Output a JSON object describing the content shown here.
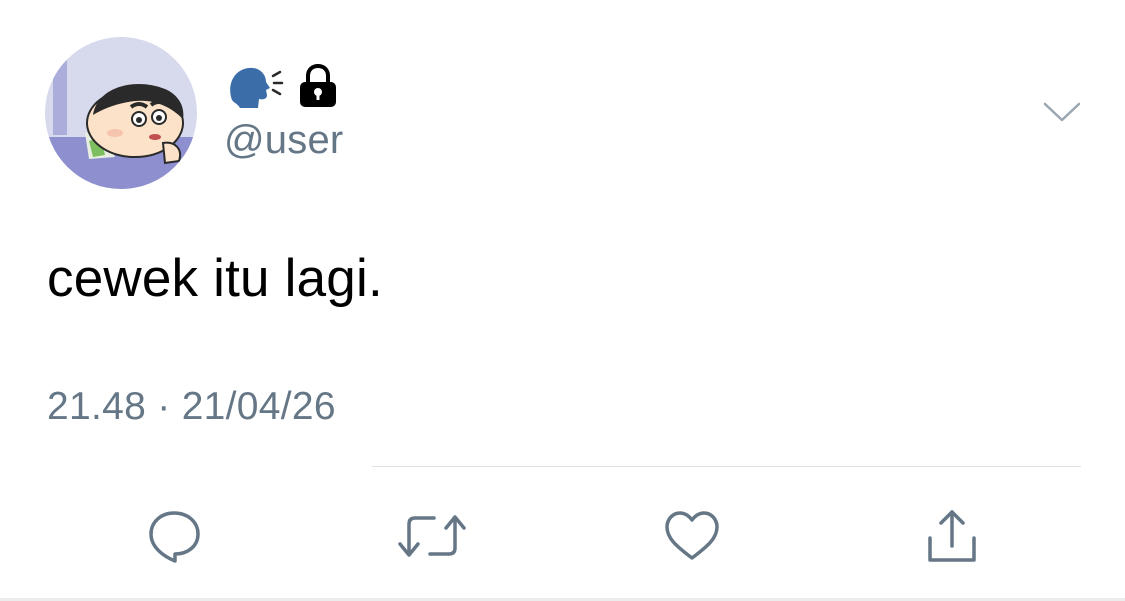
{
  "tweet": {
    "handle": "@user",
    "text": "cewek itu lagi.",
    "time": "21.48",
    "separator": "·",
    "date": "21/04/26"
  },
  "icons": {
    "name_emoji": "speaking-head-icon",
    "lock": "lock-icon",
    "menu": "chevron-down-icon",
    "reply": "reply-icon",
    "retweet": "retweet-icon",
    "like": "heart-icon",
    "share": "share-icon"
  },
  "colors": {
    "muted": "#657786",
    "icon": "#657786",
    "text": "#000000",
    "divider": "#dfe3e7"
  }
}
